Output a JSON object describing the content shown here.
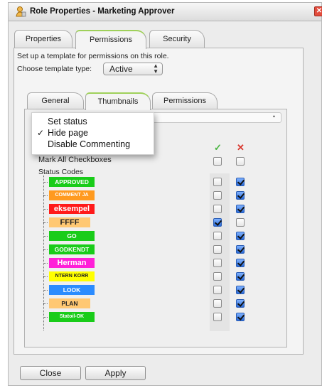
{
  "window": {
    "title": "Role Properties - Marketing Approver",
    "close_glyph": "✕",
    "title_icon": "role-icon"
  },
  "outer_tabs": [
    {
      "label": "Properties",
      "active": false
    },
    {
      "label": "Permissions",
      "active": true
    },
    {
      "label": "Security",
      "active": false
    }
  ],
  "permissions": {
    "description": "Set up a template for permissions on this role.",
    "template_label": "Choose template type:",
    "template_value": "Active"
  },
  "inner_tabs": [
    {
      "label": "General",
      "active": false
    },
    {
      "label": "Thumbnails",
      "active": true
    },
    {
      "label": "Permissions",
      "active": false
    }
  ],
  "popup_menu": {
    "items": [
      {
        "label": "Set status",
        "checked": false
      },
      {
        "label": "Hide page",
        "checked": true
      },
      {
        "label": "Disable Commenting",
        "checked": false
      }
    ],
    "check_glyph": "✓"
  },
  "grid": {
    "approve_glyph": "✓",
    "deny_glyph": "✕",
    "approve_color": "#4bb543",
    "deny_color": "#d9362c",
    "mark_all_label": "Mark All Checkboxes",
    "status_codes_label": "Status Codes",
    "mark_all": {
      "approve": false,
      "deny": false
    },
    "rows": [
      {
        "label": "APPROVED",
        "bg": "#19cc19",
        "fg": "#ffffff",
        "approve": false,
        "deny": true
      },
      {
        "label": "COMMENT JA",
        "bg": "#ff9a1f",
        "fg": "#ffffff",
        "approve": false,
        "deny": true
      },
      {
        "label": "eksempel",
        "bg": "#ff1a1a",
        "fg": "#ffffff",
        "approve": false,
        "deny": true
      },
      {
        "label": "FFFF",
        "bg": "#ffc873",
        "fg": "#222222",
        "approve": true,
        "deny": false
      },
      {
        "label": "GO",
        "bg": "#19cc19",
        "fg": "#ffffff",
        "approve": false,
        "deny": true
      },
      {
        "label": "GODKENDT",
        "bg": "#19cc19",
        "fg": "#ffffff",
        "approve": false,
        "deny": true
      },
      {
        "label": "Herman",
        "bg": "#ff1fd8",
        "fg": "#ffffff",
        "approve": false,
        "deny": true
      },
      {
        "label": "NTERN KORR",
        "bg": "#ffff00",
        "fg": "#222222",
        "approve": false,
        "deny": true
      },
      {
        "label": "LOOK",
        "bg": "#2b8cff",
        "fg": "#ffffff",
        "approve": false,
        "deny": true
      },
      {
        "label": "PLAN",
        "bg": "#ffc873",
        "fg": "#222222",
        "approve": false,
        "deny": true
      },
      {
        "label": "Statoil-OK",
        "bg": "#19cc19",
        "fg": "#ffffff",
        "approve": false,
        "deny": true
      }
    ]
  },
  "buttons": {
    "close_label": "Close",
    "apply_label": "Apply"
  }
}
